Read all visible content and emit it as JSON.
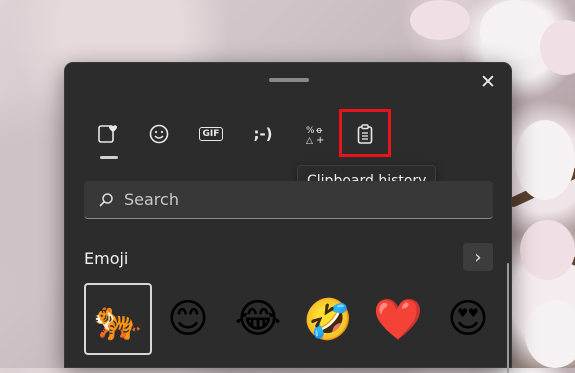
{
  "tabs": [
    {
      "name": "tab-most-recently-used",
      "icon": "heart-card-icon",
      "active": true
    },
    {
      "name": "tab-emoji",
      "icon": "smiley-icon",
      "active": false
    },
    {
      "name": "tab-gif",
      "icon": "gif-icon",
      "label": "GIF",
      "active": false
    },
    {
      "name": "tab-kaomoji",
      "icon": "kaomoji-icon",
      "label": ";-)",
      "active": false
    },
    {
      "name": "tab-symbols",
      "icon": "symbols-icon",
      "active": false
    },
    {
      "name": "tab-clipboard-history",
      "icon": "clipboard-icon",
      "active": false
    }
  ],
  "tooltip": "Clipboard history",
  "search": {
    "placeholder": "Search"
  },
  "section": {
    "title": "Emoji",
    "more": "›"
  },
  "emoji": [
    "🐅",
    "😊",
    "😂",
    "🤣",
    "❤️",
    "😍"
  ],
  "close_glyph": "✕",
  "colors": {
    "panel": "#2c2c2c",
    "highlight": "#e8141b"
  }
}
